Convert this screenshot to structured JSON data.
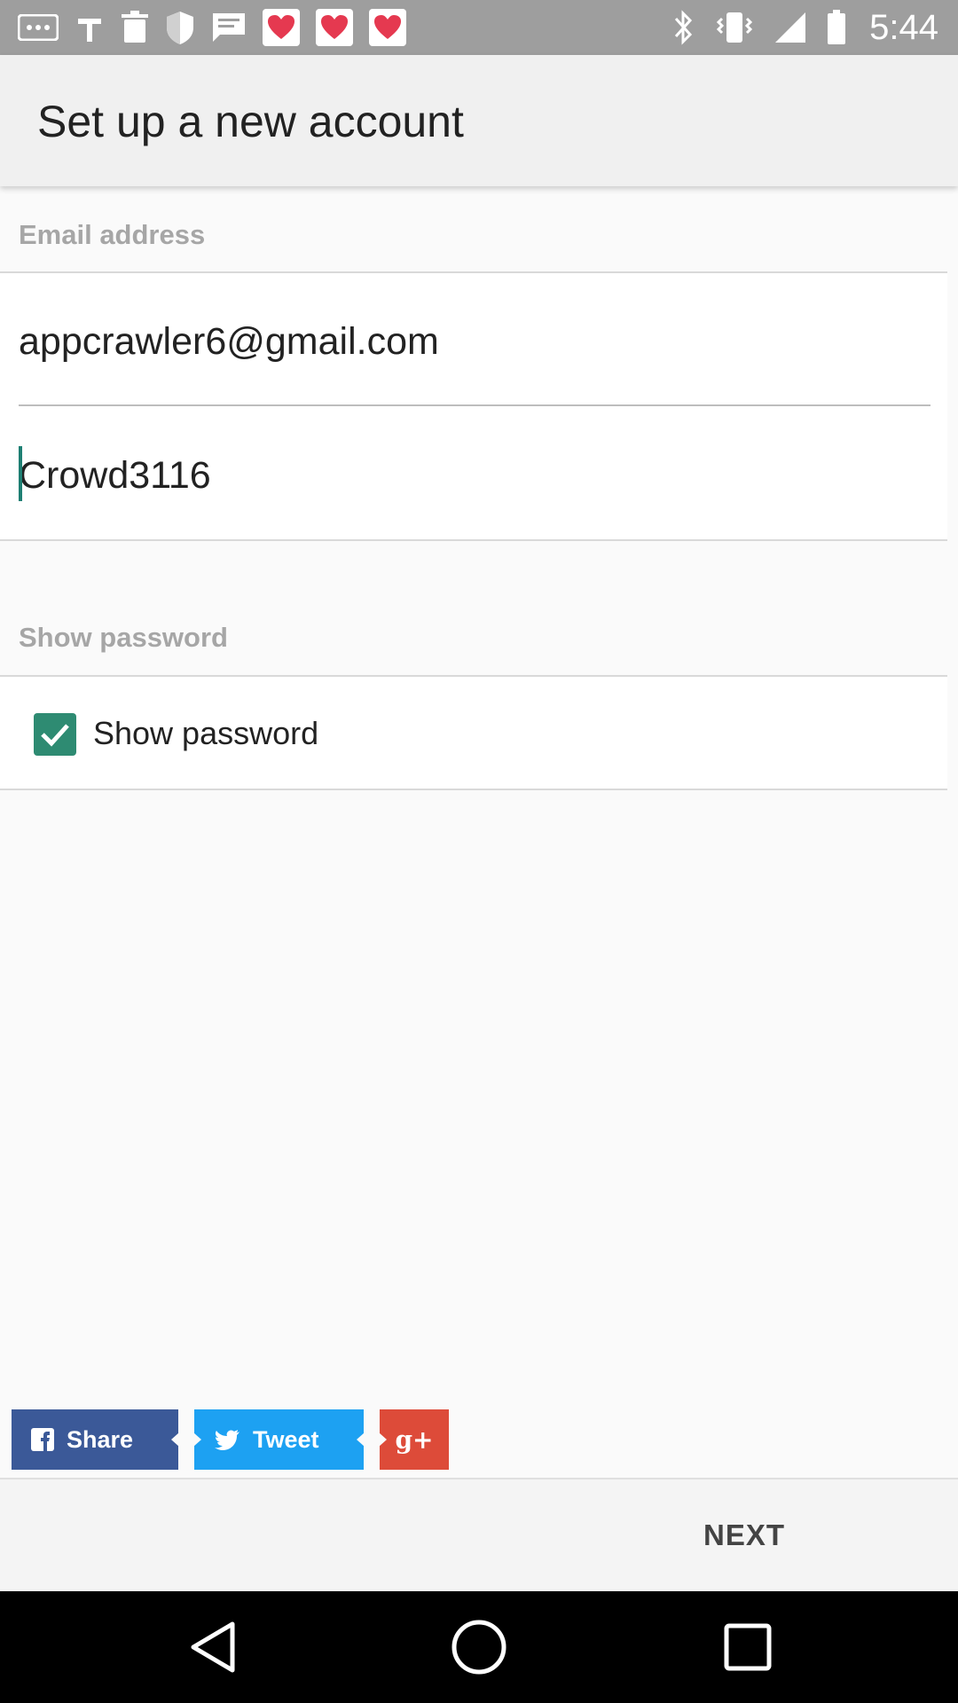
{
  "status_bar": {
    "time": "5:44",
    "notification_icons": [
      "more-icon",
      "thumb-icon",
      "delete-icon",
      "shield-icon",
      "message-icon",
      "fast-meet-icon",
      "fast-meet-icon",
      "fast-meet-icon"
    ],
    "system_icons": [
      "bluetooth-icon",
      "vibrate-icon",
      "signal-icon",
      "battery-icon"
    ]
  },
  "app_bar": {
    "title": "Set up a new account"
  },
  "email_section": {
    "label": "Email address"
  },
  "email_field": {
    "value": "appcrawler6@gmail.com"
  },
  "password_field": {
    "value": "Crowd3116"
  },
  "show_password_section": {
    "label": "Show password"
  },
  "show_password_checkbox": {
    "label": "Show password",
    "checked": true
  },
  "share": {
    "facebook_label": "Share",
    "twitter_label": "Tweet",
    "google_label": "g+"
  },
  "bottom_bar": {
    "next_label": "NEXT"
  },
  "colors": {
    "accent": "#2e8b72",
    "facebook": "#3b5998",
    "twitter": "#1da1f2",
    "google": "#dd4b39"
  }
}
